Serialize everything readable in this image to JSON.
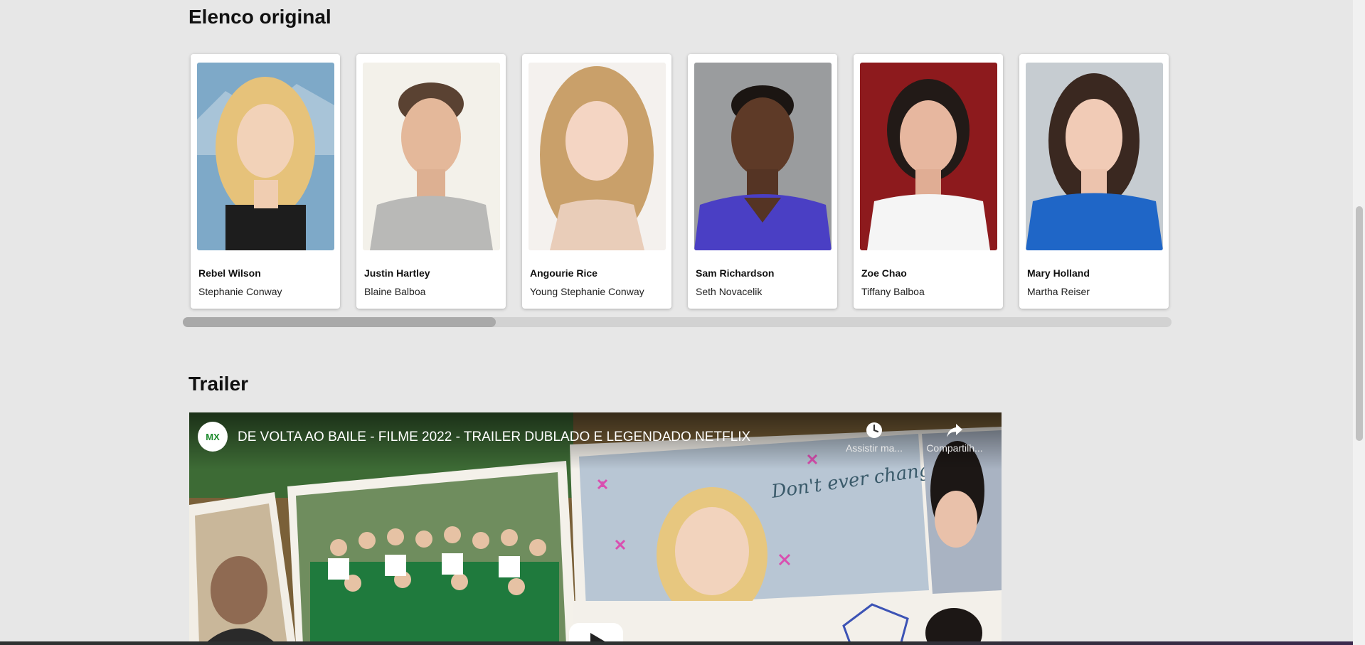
{
  "cast_section": {
    "title": "Elenco original",
    "cast": [
      {
        "actor": "Rebel Wilson",
        "character": "Stephanie Conway"
      },
      {
        "actor": "Justin Hartley",
        "character": "Blaine Balboa"
      },
      {
        "actor": "Angourie Rice",
        "character": "Young Stephanie Conway"
      },
      {
        "actor": "Sam Richardson",
        "character": "Seth Novacelik"
      },
      {
        "actor": "Zoe Chao",
        "character": "Tiffany Balboa"
      },
      {
        "actor": "Mary Holland",
        "character": "Martha Reiser"
      }
    ]
  },
  "trailer_section": {
    "title": "Trailer",
    "video": {
      "channel_badge": "MX",
      "title": "DE VOLTA AO BAILE - FILME 2022 - TRAILER DUBLADO E LEGENDADO NETFLIX",
      "watch_later_label": "Assistir ma...",
      "share_label": "Compartilh...",
      "poster_text": "Don't ever change!"
    }
  },
  "colors": {
    "page_background": "#e7e7e7",
    "card_background": "#ffffff",
    "scroll_thumb": "#a9a9a9"
  }
}
